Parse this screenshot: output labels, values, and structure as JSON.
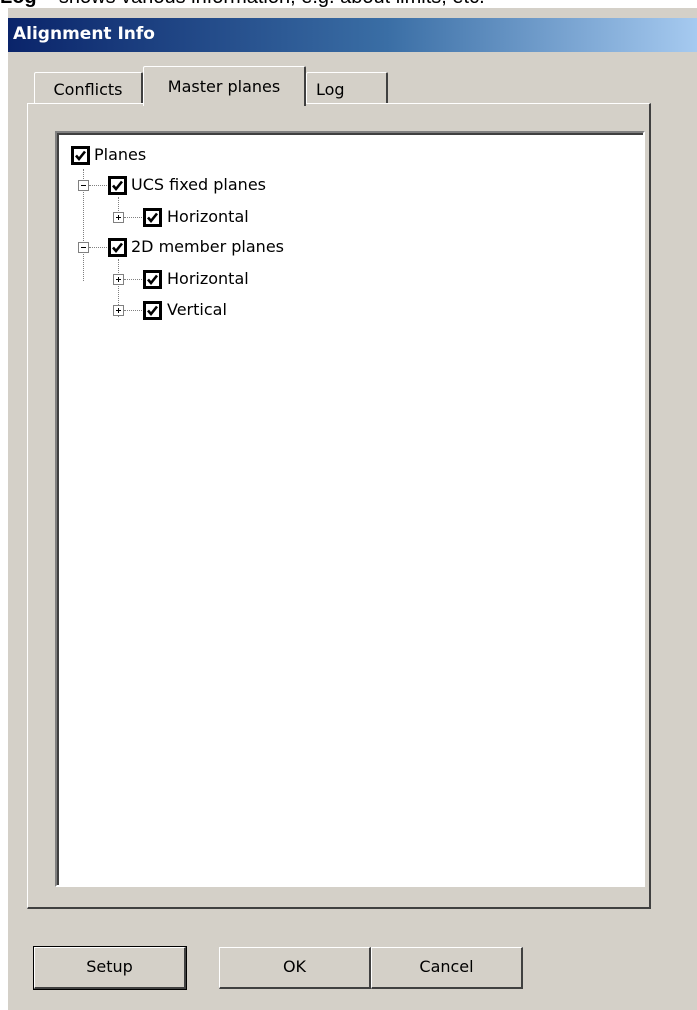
{
  "caption": {
    "bold": "Log",
    "rest": " – shows various information, e.g. about limits, etc."
  },
  "window": {
    "title": "Alignment Info"
  },
  "tabs": [
    {
      "label": "Conflicts",
      "active": false
    },
    {
      "label": "Master planes",
      "active": true
    },
    {
      "label": "Log",
      "active": false
    }
  ],
  "tree": {
    "root": {
      "label": "Planes",
      "checked": true
    },
    "groups": [
      {
        "label": "UCS fixed planes",
        "checked": true,
        "expanded": true,
        "children": [
          {
            "label": "Horizontal",
            "checked": true,
            "expanded": false
          }
        ]
      },
      {
        "label": "2D member planes",
        "checked": true,
        "expanded": true,
        "children": [
          {
            "label": "Horizontal",
            "checked": true,
            "expanded": false
          },
          {
            "label": "Vertical",
            "checked": true,
            "expanded": false
          }
        ]
      }
    ]
  },
  "buttons": {
    "setup": "Setup",
    "ok": "OK",
    "cancel": "Cancel"
  },
  "colors": {
    "dialog_bg": "#d4d0c8",
    "title_start": "#0a246a",
    "title_end": "#a6caf0"
  }
}
